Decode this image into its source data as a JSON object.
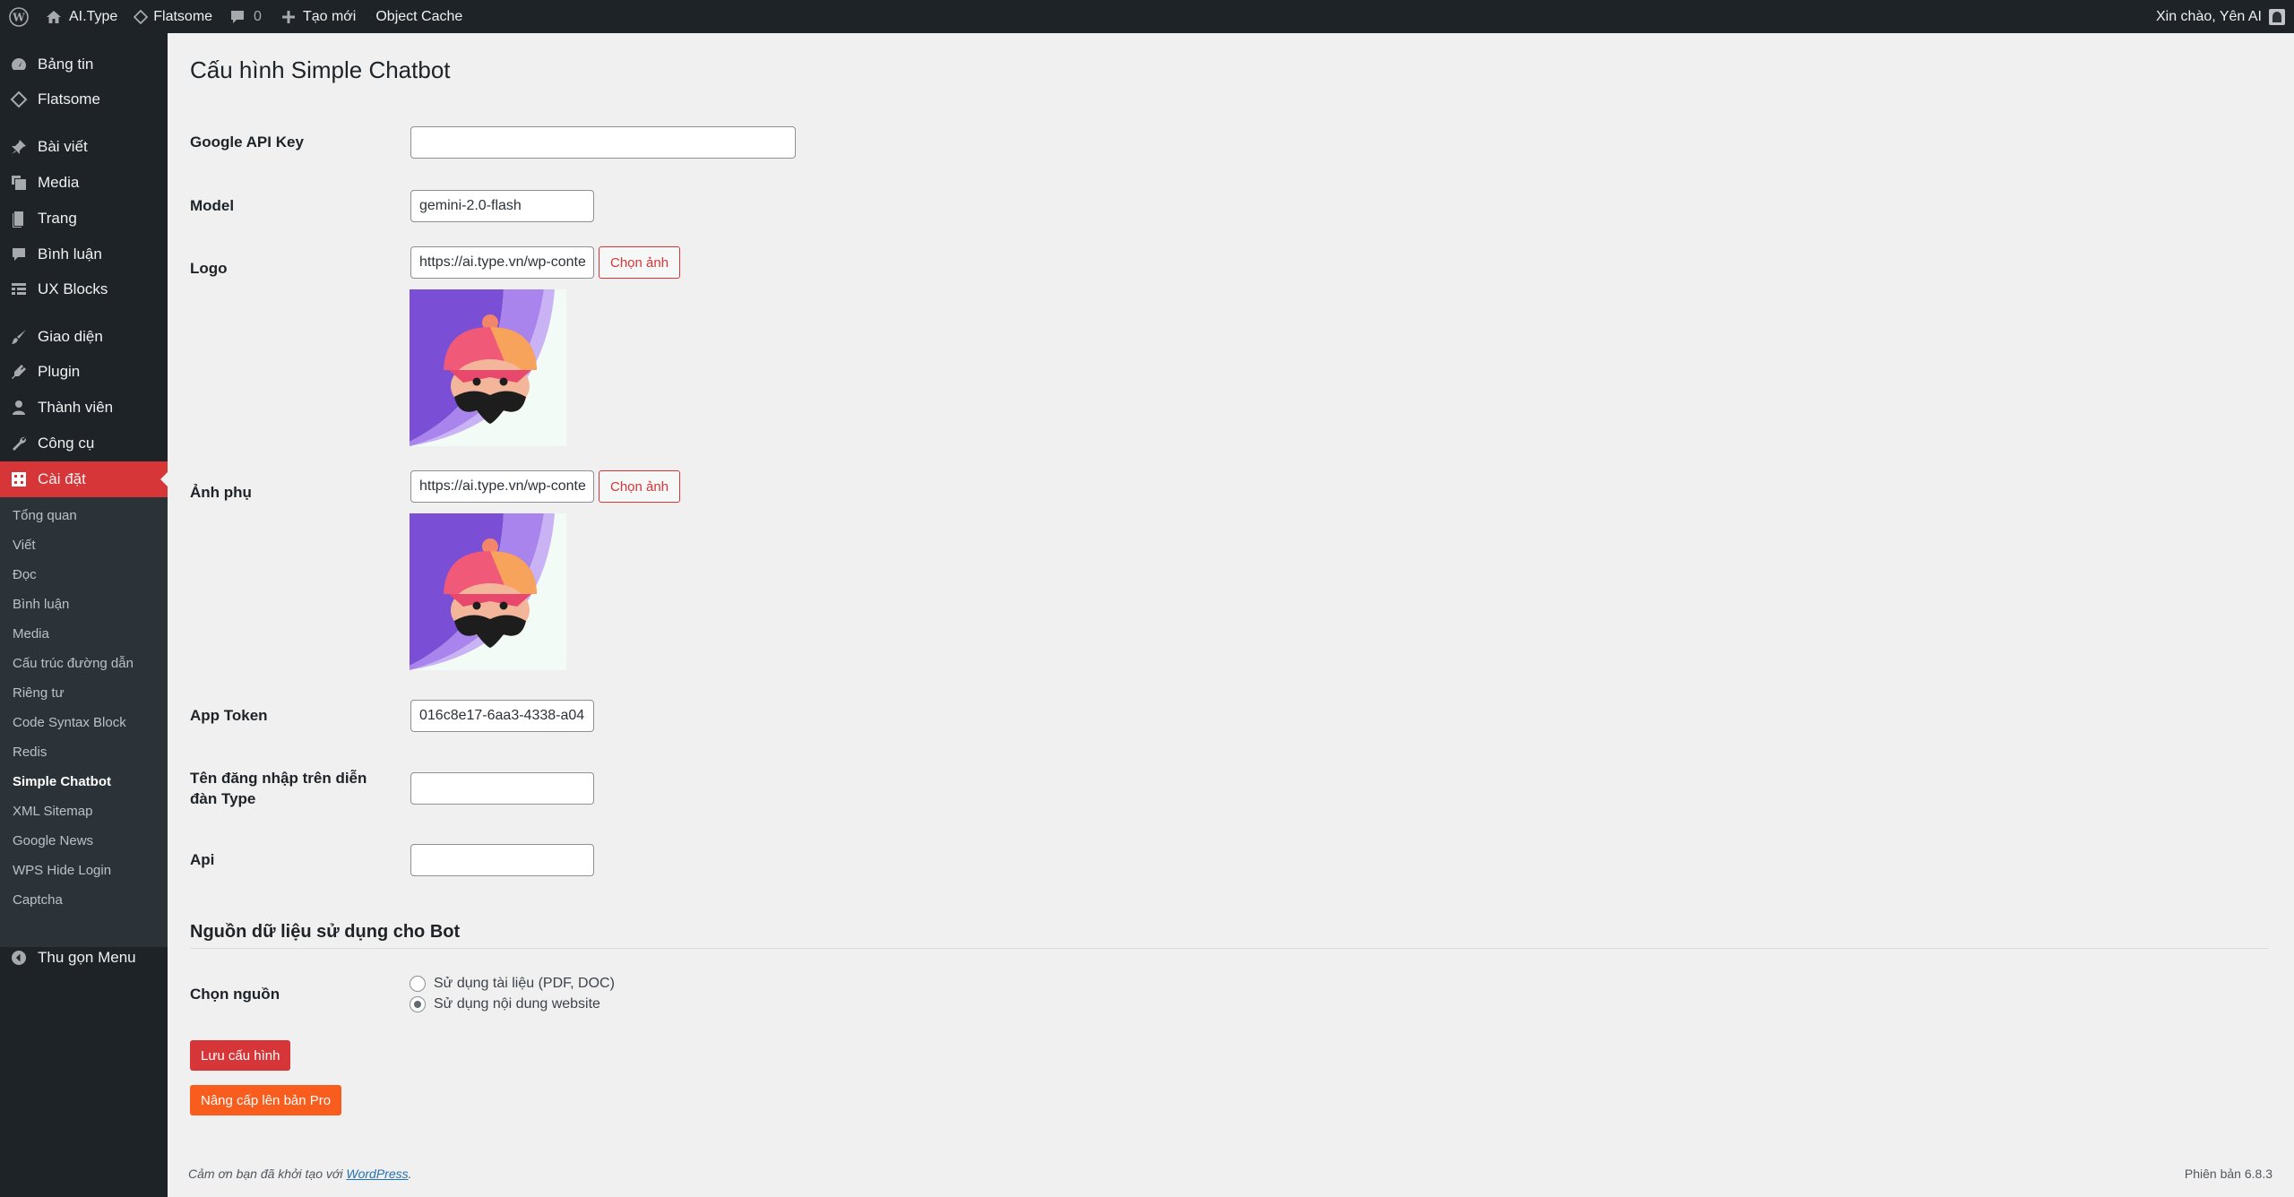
{
  "adminbar": {
    "site_name": "AI.Type",
    "theme": "Flatsome",
    "comments_count": "0",
    "new_label": "Tạo mới",
    "cache_label": "Object Cache",
    "greeting": "Xin chào, Yên AI"
  },
  "sidebar": {
    "items": [
      {
        "label": "Bảng tin",
        "icon": "dashboard-icon"
      },
      {
        "label": "Flatsome",
        "icon": "diamond-icon"
      },
      {
        "label": "Bài viết",
        "icon": "pin-icon"
      },
      {
        "label": "Media",
        "icon": "media-icon"
      },
      {
        "label": "Trang",
        "icon": "page-icon"
      },
      {
        "label": "Bình luận",
        "icon": "comment-icon"
      },
      {
        "label": "UX Blocks",
        "icon": "grid-icon"
      },
      {
        "label": "Giao diện",
        "icon": "brush-icon"
      },
      {
        "label": "Plugin",
        "icon": "plugin-icon"
      },
      {
        "label": "Thành viên",
        "icon": "user-icon"
      },
      {
        "label": "Công cụ",
        "icon": "wrench-icon"
      },
      {
        "label": "Cài đặt",
        "icon": "settings-icon"
      }
    ],
    "submenu": [
      "Tổng quan",
      "Viết",
      "Đọc",
      "Bình luận",
      "Media",
      "Cấu trúc đường dẫn",
      "Riêng tư",
      "Code Syntax Block",
      "Redis",
      "Simple Chatbot",
      "XML Sitemap",
      "Google News",
      "WPS Hide Login",
      "Captcha"
    ],
    "collapse_label": "Thu gọn Menu"
  },
  "page": {
    "title": "Cấu hình Simple Chatbot",
    "fields": {
      "api_key": {
        "label": "Google API Key",
        "value": ""
      },
      "model": {
        "label": "Model",
        "value": "gemini-2.0-flash"
      },
      "logo": {
        "label": "Logo",
        "value": "https://ai.type.vn/wp-content",
        "button": "Chọn ảnh"
      },
      "sub_image": {
        "label": "Ảnh phụ",
        "value": "https://ai.type.vn/wp-content",
        "button": "Chọn ảnh"
      },
      "app_token": {
        "label": "App Token",
        "value": "016c8e17-6aa3-4338-a04"
      },
      "forum_username": {
        "label": "Tên đăng nhập trên diễn đàn Type",
        "value": ""
      },
      "api": {
        "label": "Api",
        "value": ""
      }
    },
    "section_title": "Nguồn dữ liệu sử dụng cho Bot",
    "source": {
      "label": "Chọn nguồn",
      "options": [
        "Sử dụng tài liệu (PDF, DOC)",
        "Sử dụng nội dung website"
      ],
      "selected_index": 1
    },
    "save_button": "Lưu cấu hình",
    "upgrade_button": "Nâng cấp lên bản Pro"
  },
  "footer": {
    "thanks_prefix": "Cảm ơn bạn đã khởi tạo với ",
    "thanks_link": "WordPress",
    "thanks_suffix": ".",
    "version": "Phiên bản 6.8.3"
  },
  "colors": {
    "accent": "#d63638",
    "upgrade": "#f95d1e",
    "sidebar_bg": "#1d2327"
  }
}
